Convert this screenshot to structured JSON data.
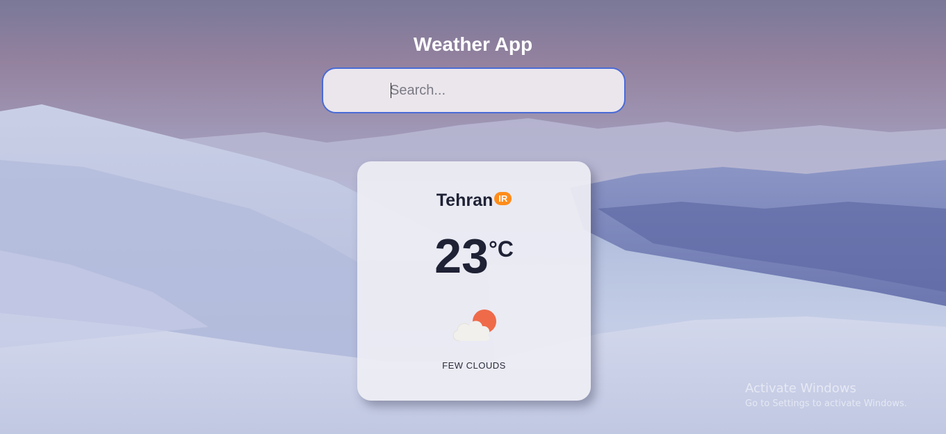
{
  "app": {
    "title": "Weather App"
  },
  "search": {
    "placeholder": "Search...",
    "value": ""
  },
  "weather": {
    "city": "Tehran",
    "country": "IR",
    "temperature": "23",
    "unit": "°C",
    "description": "FEW CLOUDS",
    "icon": "few-clouds-icon"
  },
  "overlay": {
    "activate_title": "Activate Windows",
    "activate_subtitle": "Go to Settings to activate Windows."
  },
  "colors": {
    "search_border": "#4a6ad6",
    "country_badge": "#ff8c1a",
    "sun": "#f06a4a",
    "text_dark": "#1f2235"
  }
}
